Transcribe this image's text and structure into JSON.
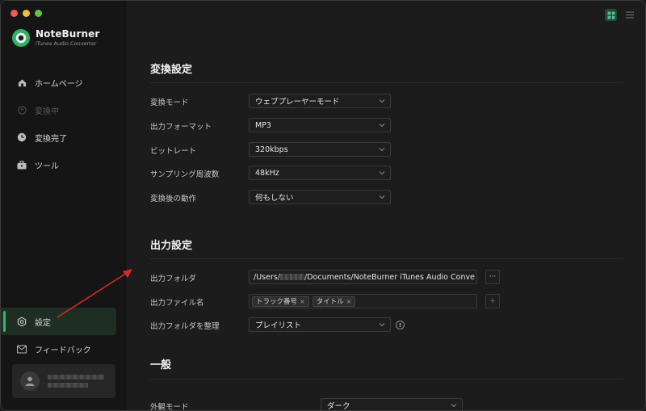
{
  "app": {
    "name": "NoteBurner",
    "subtitle": "iTunes Audio Converter"
  },
  "sidebar": {
    "items": [
      {
        "label": "ホームページ",
        "icon": "home-icon"
      },
      {
        "label": "変換中",
        "icon": "converting-icon",
        "disabled": true
      },
      {
        "label": "変換完了",
        "icon": "clock-icon"
      },
      {
        "label": "ツール",
        "icon": "toolbox-icon"
      }
    ],
    "bottom_items": [
      {
        "label": "設定",
        "icon": "settings-icon",
        "active": true
      },
      {
        "label": "フィードバック",
        "icon": "mail-icon"
      }
    ]
  },
  "conversion_settings": {
    "title": "変換設定",
    "rows": [
      {
        "label": "変換モード",
        "value": "ウェブプレーヤーモード"
      },
      {
        "label": "出力フォーマット",
        "value": "MP3"
      },
      {
        "label": "ビットレート",
        "value": "320kbps"
      },
      {
        "label": "サンプリング周波数",
        "value": "48kHz"
      },
      {
        "label": "変換後の動作",
        "value": "何もしない"
      }
    ]
  },
  "output_settings": {
    "title": "出力設定",
    "folder_label": "出力フォルダ",
    "folder_path_prefix": "/Users/",
    "folder_path_suffix": "/Documents/NoteBurner iTunes Audio Conve",
    "browse_button": "···",
    "filename_label": "出力ファイル名",
    "filename_tags": [
      "トラック番号",
      "タイトル"
    ],
    "add_button": "+",
    "organize_label": "出力フォルダを整理",
    "organize_value": "プレイリスト",
    "info_glyph": "!"
  },
  "general": {
    "title": "一般",
    "appearance_label": "外観モード",
    "appearance_value": "ダーク"
  },
  "colors": {
    "accent": "#38b468",
    "annotation_arrow": "#d62828"
  }
}
